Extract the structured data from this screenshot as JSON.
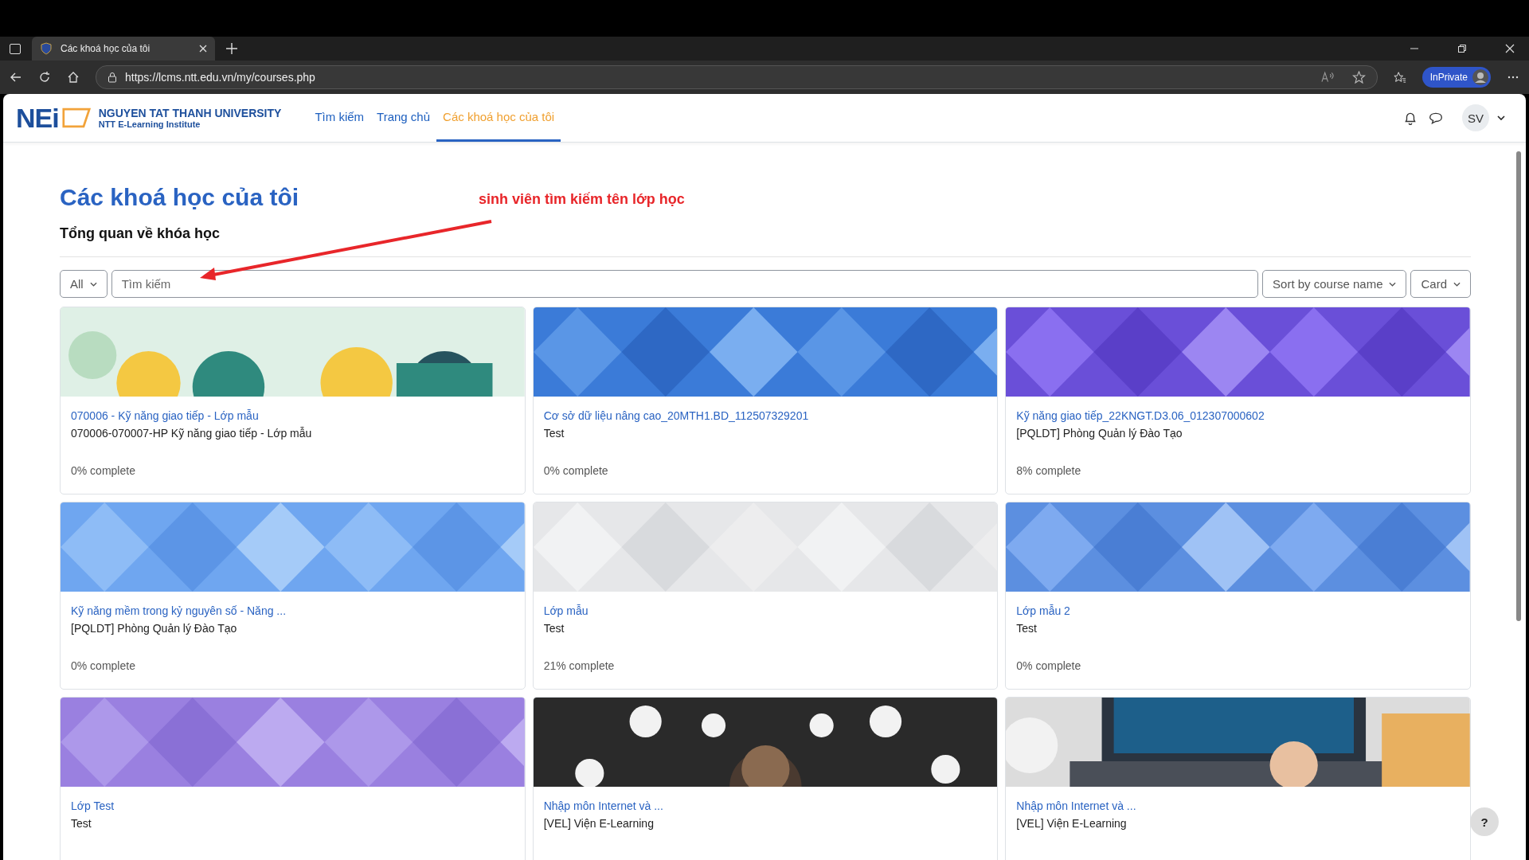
{
  "browser": {
    "tab_title": "Các khoá học của tôi",
    "url": "https://lcms.ntt.edu.vn/my/courses.php",
    "profile_label": "InPrivate"
  },
  "site": {
    "logo_mark": "NEi",
    "university": "NGUYEN TAT THANH UNIVERSITY",
    "institute": "NTT E-Learning Institute"
  },
  "nav": [
    {
      "label": "Tìm kiếm",
      "selected": false
    },
    {
      "label": "Trang chủ",
      "selected": false
    },
    {
      "label": "Các khoá học của tôi",
      "selected": true
    }
  ],
  "user": {
    "initials": "SV"
  },
  "page": {
    "title": "Các khoá học của tôi",
    "subtitle": "Tổng quan về khóa học"
  },
  "annotation": {
    "text": "sinh viên tìm kiếm tên lớp học"
  },
  "filters": {
    "grouping": "All",
    "search_placeholder": "Tìm kiếm",
    "sort": "Sort by course name",
    "view": "Card"
  },
  "courses": [
    {
      "name": "070006 - Kỹ năng giao tiếp - Lớp mẫu",
      "category": "070006-070007-HP Kỹ năng giao tiếp - Lớp mẫu",
      "progress": "0% complete"
    },
    {
      "name": "Cơ sở dữ liệu nâng cao_20MTH1.BD_112507329201",
      "category": "Test",
      "progress": "0% complete"
    },
    {
      "name": "Kỹ năng giao tiếp_22KNGT.D3.06_012307000602",
      "category": "[PQLDT] Phòng Quản lý Đào Tạo",
      "progress": "8% complete"
    },
    {
      "name": "Kỹ năng mềm trong kỷ nguyên số - Năng ...",
      "category": "[PQLDT] Phòng Quản lý Đào Tạo",
      "progress": "0% complete"
    },
    {
      "name": "Lớp mẫu",
      "category": "Test",
      "progress": "21% complete"
    },
    {
      "name": "Lớp mẫu 2",
      "category": "Test",
      "progress": "0% complete"
    },
    {
      "name": "Lớp Test",
      "category": "Test"
    },
    {
      "name": "Nhập môn Internet và ...",
      "category": "[VEL] Viện E-Learning"
    },
    {
      "name": "Nhập môn Internet và ...",
      "category": "[VEL] Viện E-Learning"
    }
  ],
  "help_button": "?"
}
